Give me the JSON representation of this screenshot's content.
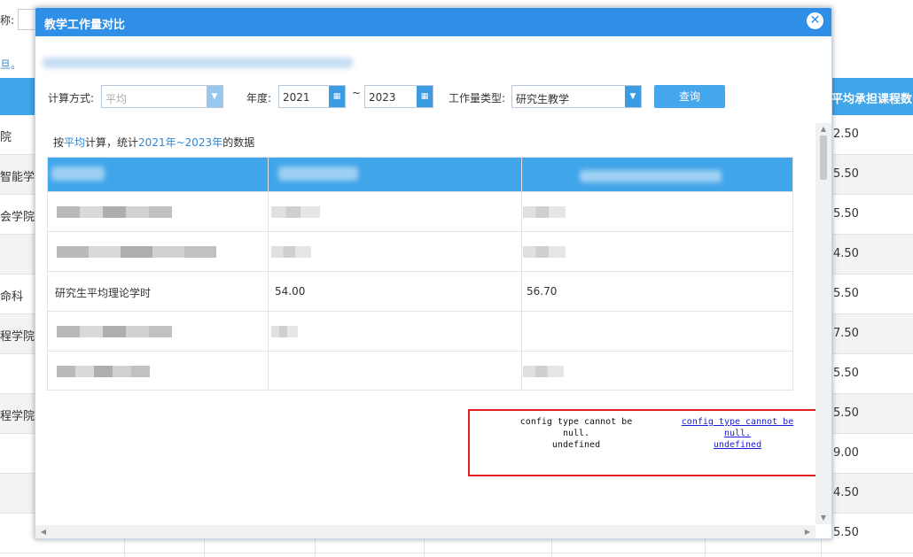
{
  "background": {
    "topbar_label": "称:",
    "top_note": "旦。",
    "header_right": "平均承担课程数",
    "rows": [
      {
        "left": "院",
        "right": "2.50"
      },
      {
        "left": "智能学",
        "right": "5.50"
      },
      {
        "left": "会学院",
        "right": "5.50"
      },
      {
        "left": "",
        "right": "4.50"
      },
      {
        "left": "命科",
        "right": "5.50"
      },
      {
        "left": "程学院",
        "right": "7.50"
      },
      {
        "left": "",
        "right": "5.50"
      },
      {
        "left": "程学院",
        "right": "5.50"
      },
      {
        "left": "",
        "right": "9.00"
      },
      {
        "left": "",
        "right": "4.50"
      },
      {
        "left": "",
        "right": "5.50"
      }
    ]
  },
  "modal": {
    "title": "教学工作量对比",
    "close_icon": "close-circle-icon",
    "toolbar": {
      "method_label": "计算方式:",
      "method_value": "平均",
      "year_label": "年度:",
      "year_from": "2021",
      "tilde": "~",
      "year_to": "2023",
      "type_label": "工作量类型:",
      "type_value": "研究生教学",
      "query_label": "查询",
      "calendar_icon": "calendar-icon",
      "dropdown_icon": "chevron-down-icon"
    },
    "summary": {
      "prefix": "按",
      "method": "平均",
      "middle": "计算，统计",
      "range": "2021年~2023年",
      "suffix": "的数据"
    },
    "table": {
      "rows": [
        {
          "name": "",
          "value": "",
          "other": ""
        },
        {
          "name": "",
          "value": "",
          "other": ""
        },
        {
          "name": "研究生平均理论学时",
          "value": "54.00",
          "other": "56.70"
        },
        {
          "name": "",
          "value": "",
          "other": ""
        },
        {
          "name": "",
          "value": "",
          "other": ""
        }
      ]
    },
    "error": {
      "left_line1": "config type cannot be",
      "left_line2": "null.",
      "left_line3": "undefined",
      "right_line1": "config type cannot be",
      "right_line2": "null.",
      "right_line3": "undefined"
    }
  }
}
